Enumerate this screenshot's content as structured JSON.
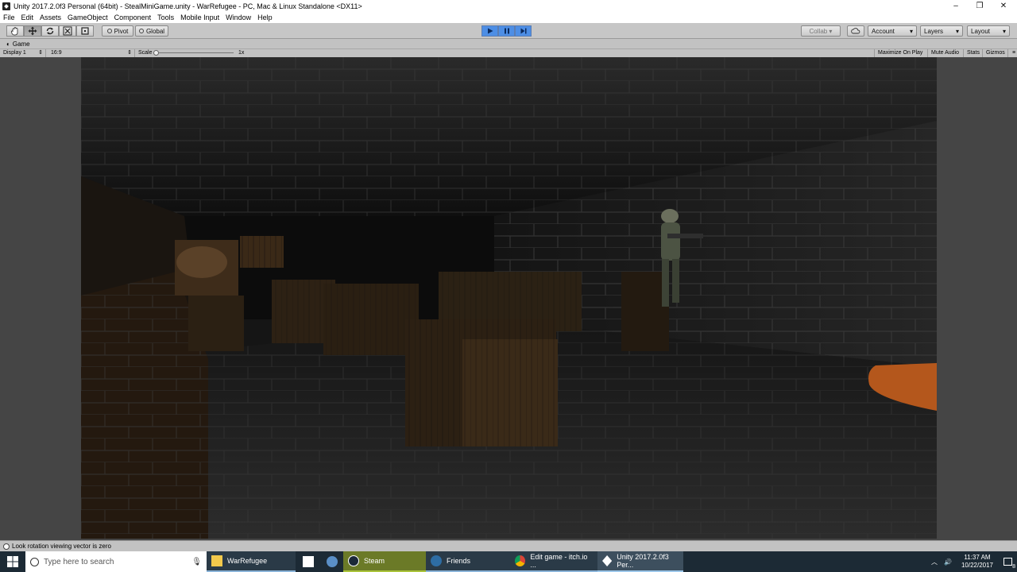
{
  "window": {
    "title": "Unity 2017.2.0f3 Personal (64bit) - StealMiniGame.unity - WarRefugee - PC, Mac & Linux Standalone <DX11>",
    "minimize": "–",
    "restore": "❐",
    "close": "✕"
  },
  "menu": [
    "File",
    "Edit",
    "Assets",
    "GameObject",
    "Component",
    "Tools",
    "Mobile Input",
    "Window",
    "Help"
  ],
  "toolbar": {
    "pivot": "Pivot",
    "global": "Global",
    "collab": "Collab ▾",
    "account": "Account",
    "layers": "Layers",
    "layout": "Layout"
  },
  "game_panel": {
    "tab": "Game",
    "display": "Display 1",
    "aspect": "16:9",
    "scale_label": "Scale",
    "scale_value": "1x",
    "maximize_on_play": "Maximize On Play",
    "mute_audio": "Mute Audio",
    "stats": "Stats",
    "gizmos": "Gizmos"
  },
  "status": {
    "message": "Look rotation viewing vector is zero"
  },
  "taskbar": {
    "search_placeholder": "Type here to search",
    "items": [
      "WarRefugee",
      "Steam",
      "Friends",
      "Edit game - itch.io ...",
      "Unity 2017.2.0f3 Per..."
    ],
    "time": "11:37 AM",
    "date": "10/22/2017",
    "notifications": "8"
  },
  "colors": {
    "toolbar_bg": "#c2c2c2",
    "play_accent": "#4d8ee5",
    "taskbar_bg": "#1c2a35",
    "steam_highlight": "#6b7a27"
  }
}
